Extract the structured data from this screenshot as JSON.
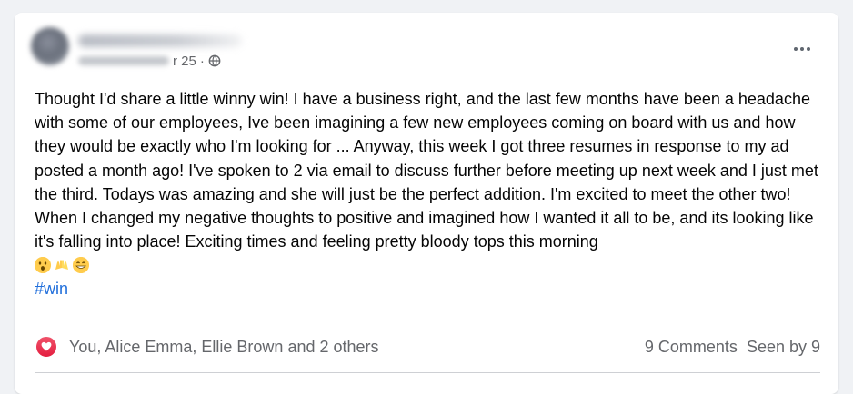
{
  "post": {
    "date_suffix": "r 25",
    "date_separator": "·",
    "paragraph_1": "Thought I'd share a little winny win! I have a business right, and the last few months have been a headache with some of our employees, Ive been imagining a few new employees coming on board with us and how they would be exactly who I'm looking for ... Anyway, this week I got three resumes in response to my ad posted a month ago! I've spoken to 2 via email to discuss further before meeting up next week and I just met the third. Todays was amazing and she will just be the perfect addition. I'm excited to meet the other two!",
    "paragraph_2": "When I changed my negative thoughts to positive and imagined how I wanted it all to be, and its looking like it's falling into place! Exciting times and feeling pretty bloody tops this morning",
    "emojis": [
      "😲",
      "🙌",
      "😁"
    ],
    "hashtag": "#win"
  },
  "footer": {
    "reactors": "You, Alice Emma, Ellie Brown and 2 others",
    "comments": "9 Comments",
    "seen_by": "Seen by 9"
  },
  "icons": {
    "privacy": "globe-icon",
    "menu": "more-options-icon",
    "reaction": "heart-icon"
  },
  "colors": {
    "hashtag": "#216fdb",
    "reaction": "#e41e3f",
    "secondary_text": "#65676b"
  }
}
